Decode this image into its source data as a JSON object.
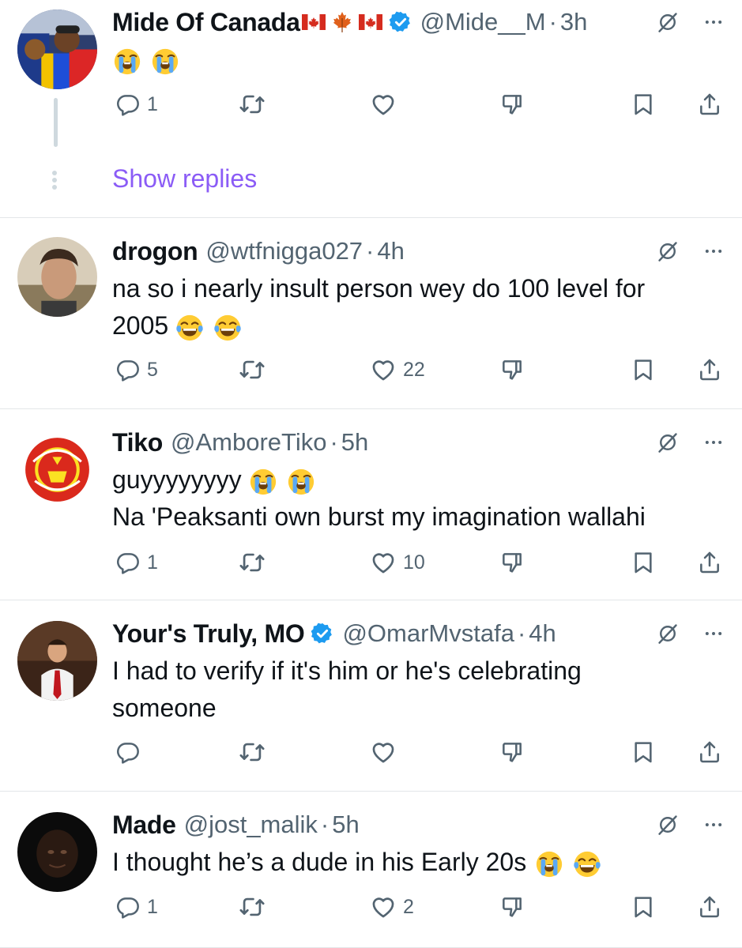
{
  "tweets": [
    {
      "name": "Mide Of Canada",
      "flags": [
        "canada-flag",
        "maple-leaf",
        "canada-flag"
      ],
      "verified": true,
      "handle": "@Mide__M",
      "separator": "·",
      "time": "3h",
      "text_line1": "",
      "text_line2": "",
      "emojis": [
        "loudly-crying",
        "loudly-crying"
      ],
      "replies": "1",
      "retweets": "",
      "likes": "",
      "show_replies_label": "Show replies"
    },
    {
      "name": "drogon",
      "verified": false,
      "handle": "@wtfnigga027",
      "separator": "·",
      "time": "4h",
      "text_line1": "na so i nearly insult person wey do 100 level for",
      "text_line2": "2005",
      "emojis": [
        "tears-of-joy",
        "tears-of-joy"
      ],
      "replies": "5",
      "retweets": "",
      "likes": "22"
    },
    {
      "name": "Tiko",
      "verified": false,
      "handle": "@AmboreTiko",
      "separator": "·",
      "time": "5h",
      "text_line1": "guyyyyyyyy",
      "text_line2": "Na 'Peaksanti own burst my imagination wallahi",
      "emojis": [
        "loudly-crying",
        "loudly-crying"
      ],
      "replies": "1",
      "retweets": "",
      "likes": "10"
    },
    {
      "name": "Your's Truly, MO",
      "verified": true,
      "handle": "@OmarMvstafa",
      "separator": "·",
      "time": "4h",
      "text_line1": "I had to verify if it's him or he's celebrating",
      "text_line2": "someone",
      "emojis": [],
      "replies": "",
      "retweets": "",
      "likes": ""
    },
    {
      "name": "Made",
      "verified": false,
      "handle": "@jost_malik",
      "separator": "·",
      "time": "5h",
      "text_line1": "I thought he’s a dude in his Early 20s",
      "text_line2": "",
      "emojis": [
        "loudly-crying",
        "tears-of-joy"
      ],
      "replies": "1",
      "retweets": "",
      "likes": "2"
    }
  ],
  "colors": {
    "text": "#0f1419",
    "secondary": "#536471",
    "verified": "#1d9bf0",
    "show_replies": "#8b5cf6",
    "divider": "#e3e6e9"
  }
}
